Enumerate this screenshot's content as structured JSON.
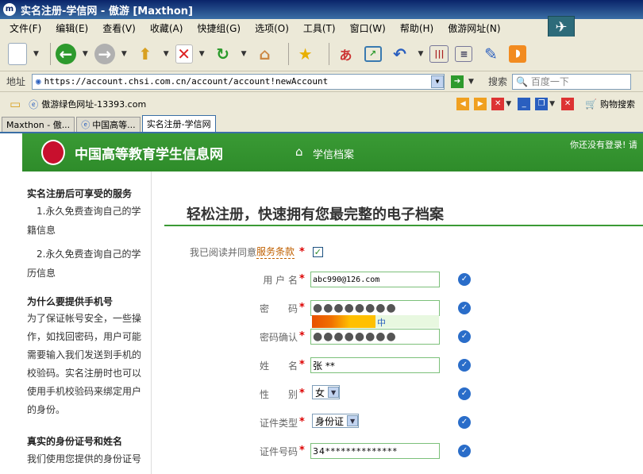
{
  "window": {
    "title": "实名注册-学信网 - 傲游 [Maxthon]"
  },
  "menu": [
    "文件(F)",
    "编辑(E)",
    "查看(V)",
    "收藏(A)",
    "快捷组(G)",
    "选项(O)",
    "工具(T)",
    "窗口(W)",
    "帮助(H)",
    "傲游网址(N)"
  ],
  "addressbar": {
    "label": "地址",
    "url": "https://account.chsi.com.cn/account/account!newAccount",
    "search_label": "搜索",
    "search_placeholder": "百度一下"
  },
  "favbar": {
    "site_label": "傲游绿色网址-13393.com",
    "shopping_label": "购物搜索"
  },
  "tabs": [
    "Maxthon - 傲...",
    "中国高等...",
    "实名注册-学信网"
  ],
  "site": {
    "name": "中国高等教育学生信息网",
    "nav_label": "学信档案",
    "login_status": "你还没有登录! 请"
  },
  "sidebar": {
    "heading1": "实名注册后可享受的服务",
    "item1": "1.永久免费查询自己的学籍信息",
    "item2": "2.永久免费查询自己的学历信息",
    "heading2": "为什么要提供手机号",
    "para2": "为了保证帐号安全，一些操作，如找回密码，用户可能需要输入我们发送到手机的校验码。实名注册时也可以使用手机校验码来绑定用户的身份。",
    "heading3": "真实的身份证号和姓名",
    "para3": "我们使用您提供的身份证号"
  },
  "form": {
    "title": "轻松注册，快速拥有您最完整的电子档案",
    "agree_text": "我已阅读并同意",
    "agree_link": "服务条款",
    "username_label": "用 户 名",
    "username_value": "abc990@126.com",
    "password_label": "密　　码",
    "password_value": "●●●●●●●●",
    "strength_label": "中",
    "strength_level": 0.5,
    "confirm_label": "密码确认",
    "confirm_value": "●●●●●●●●",
    "name_label": "姓　　名",
    "name_value": "张 **",
    "gender_label": "性　　别",
    "gender_value": "女",
    "idtype_label": "证件类型",
    "idtype_value": "身份证",
    "idnum_label": "证件号码",
    "idnum_value": "34**************"
  },
  "colors": {
    "header_green": "#2e8c2a",
    "check_blue": "#2a6dc9",
    "required_red": "#d00"
  }
}
